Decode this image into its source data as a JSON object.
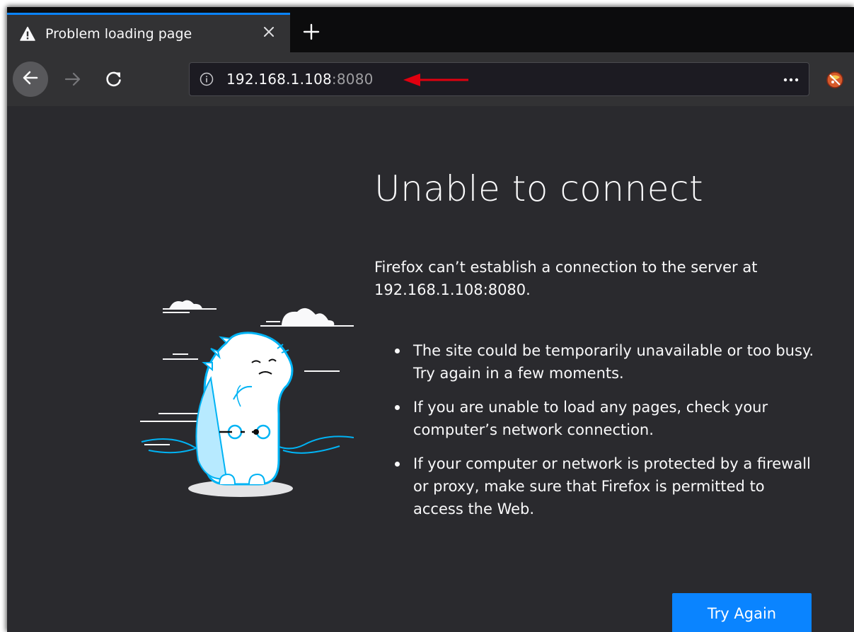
{
  "tab": {
    "title": "Problem loading page",
    "icon": "warning-icon"
  },
  "navbar": {
    "url_host": "192.168.1.108",
    "url_port": ":8080",
    "icons": [
      "back-arrow-icon",
      "forward-arrow-icon",
      "reload-icon",
      "info-icon",
      "more-horizontal-icon",
      "extension-icon"
    ]
  },
  "error": {
    "title": "Unable to connect",
    "description": "Firefox can’t establish a connection to the server at 192.168.1.108:8080.",
    "items": [
      "The site could be temporarily unavailable or too busy. Try again in a few moments.",
      "If you are unable to load any pages, check your computer’s network connection.",
      "If your computer or network is protected by a firewall or proxy, make sure that Firefox is permitted to access the Web."
    ],
    "button": "Try Again"
  },
  "colors": {
    "accent": "#0a84ff",
    "annotation_arrow": "#e0000f",
    "page_background": "#2a2a2e",
    "illustration_outline": "#00b3f4"
  }
}
